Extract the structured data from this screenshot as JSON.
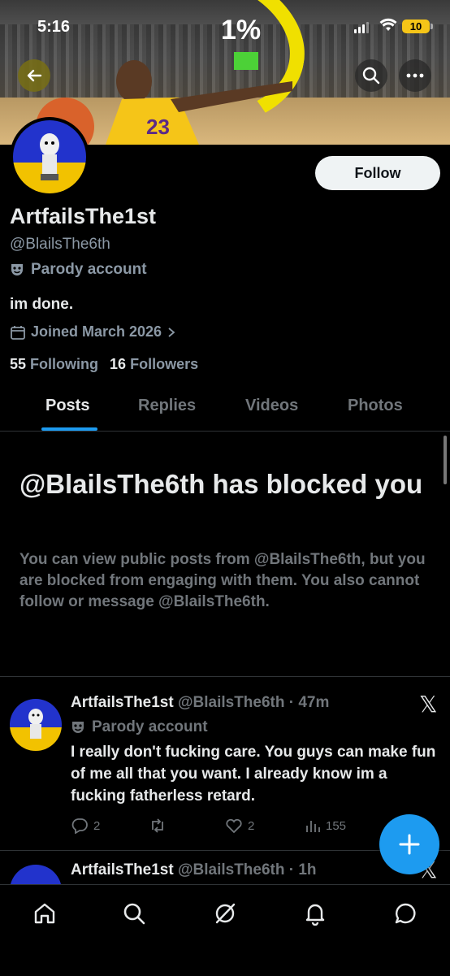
{
  "status_bar": {
    "time": "5:16",
    "battery": "10"
  },
  "banner": {
    "overlay_text": "1%"
  },
  "profile": {
    "display_name": "ArtfailsThe1st",
    "handle": "@BlailsThe6th",
    "label": "Parody account",
    "bio": "im done.",
    "joined": "Joined March 2026",
    "following_count": "55",
    "following_label": "Following",
    "followers_count": "16",
    "followers_label": "Followers",
    "follow_button": "Follow"
  },
  "tabs": [
    {
      "label": "Posts",
      "active": true
    },
    {
      "label": "Replies",
      "active": false
    },
    {
      "label": "Videos",
      "active": false
    },
    {
      "label": "Photos",
      "active": false
    }
  ],
  "blocked": {
    "title": "@BlailsThe6th has blocked you",
    "description": "You can view public posts from @BlailsThe6th, but you are blocked from engaging with them. You also cannot follow or message @BlailsThe6th."
  },
  "posts": [
    {
      "name": "ArtfailsThe1st",
      "meta": "@BlailsThe6th · 47m",
      "label": "Parody account",
      "text": "I really don't fucking care. You guys can make fun of me all that you want. I already know im a fucking fatherless retard.",
      "replies": "2",
      "reposts": "",
      "likes": "2",
      "views": "155"
    },
    {
      "name": "ArtfailsThe1st",
      "meta": "@BlailsThe6th · 1h"
    }
  ],
  "colors": {
    "accent": "#1d9bf0",
    "muted": "#71767b",
    "background": "#000000"
  }
}
